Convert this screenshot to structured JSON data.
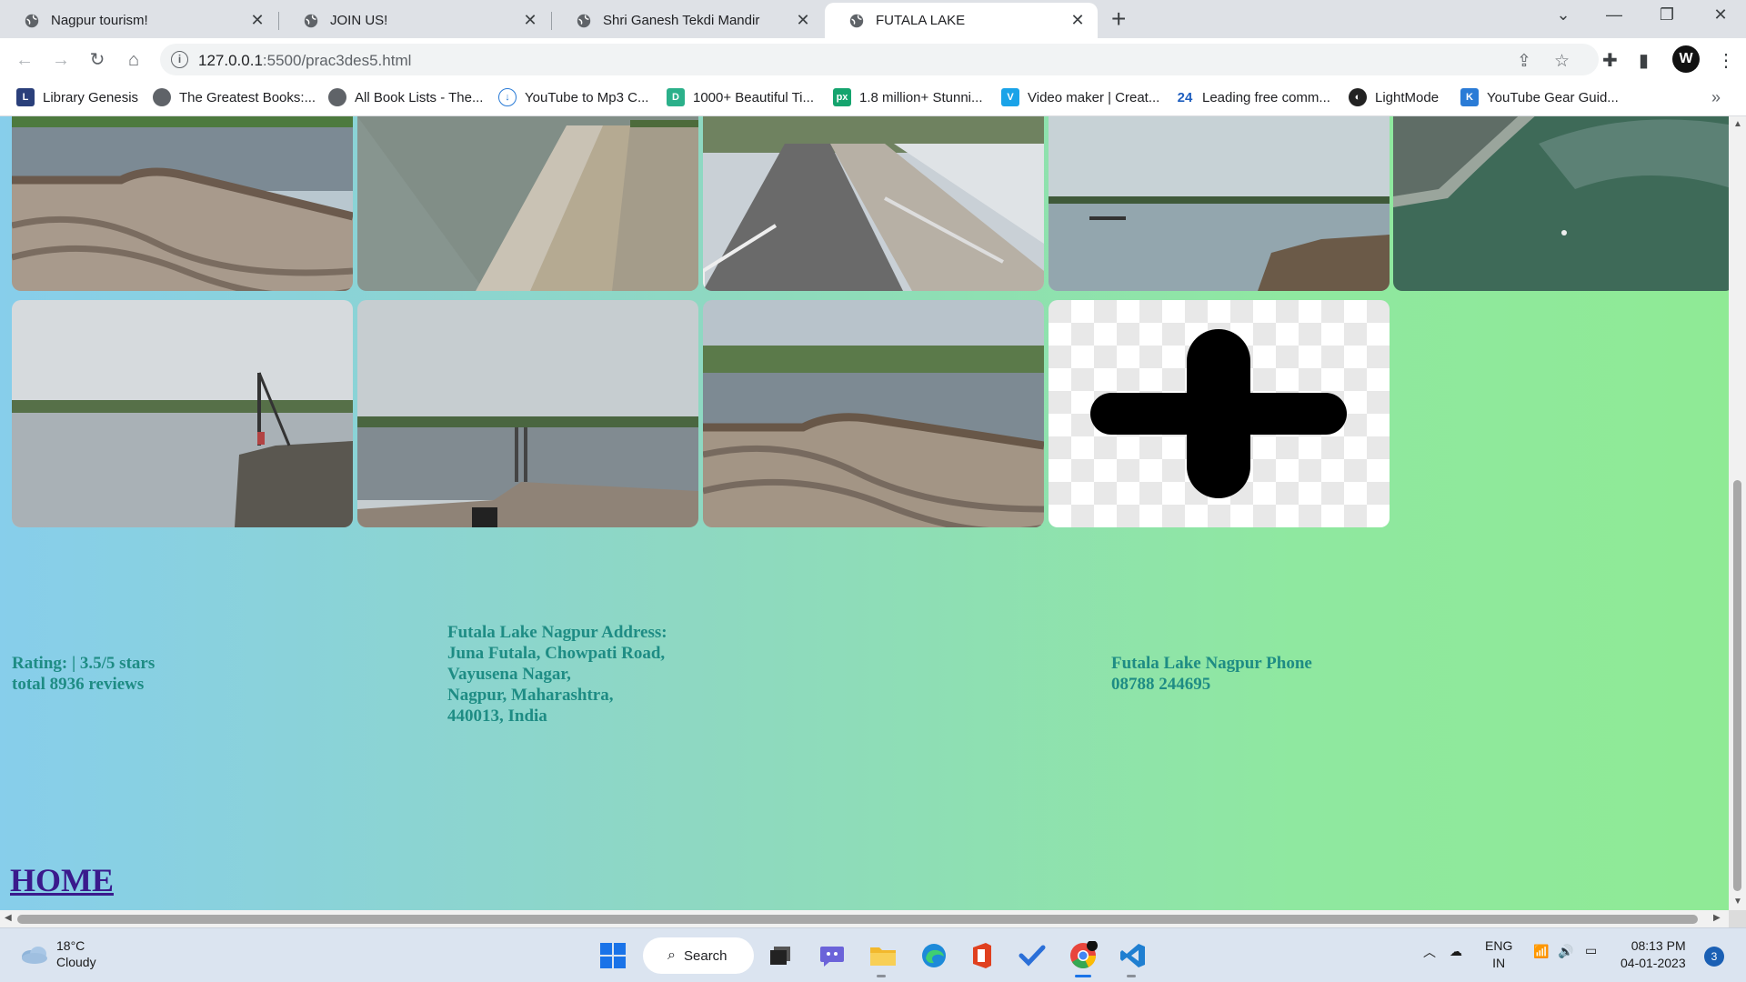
{
  "browser": {
    "tabs": [
      {
        "title": "Nagpur tourism!",
        "active": false
      },
      {
        "title": "JOIN US!",
        "active": false
      },
      {
        "title": "Shri Ganesh Tekdi Mandir",
        "active": false
      },
      {
        "title": "FUTALA LAKE",
        "active": true
      }
    ],
    "new_tab_label": "+",
    "url_host": "127.0.0.1",
    "url_rest": ":5500/prac3des5.html",
    "bookmarks": [
      {
        "label": "Library Genesis",
        "icon": "library-genesis-icon"
      },
      {
        "label": "The Greatest Books:...",
        "icon": "globe-icon"
      },
      {
        "label": "All Book Lists - The...",
        "icon": "globe-icon"
      },
      {
        "label": "YouTube to Mp3 C...",
        "icon": "cloud-download-icon"
      },
      {
        "label": "1000+ Beautiful Ti...",
        "icon": "d-letter-icon"
      },
      {
        "label": "1.8 million+ Stunni...",
        "icon": "px-icon"
      },
      {
        "label": "Video maker | Creat...",
        "icon": "v-letter-icon"
      },
      {
        "label": "Leading free comm...",
        "icon": "24-icon"
      },
      {
        "label": "LightMode",
        "icon": "lightmode-icon"
      },
      {
        "label": "YouTube Gear Guid...",
        "icon": "k-letter-icon"
      }
    ],
    "bookmarks_more": "»"
  },
  "page": {
    "rating_line1": "Rating: | 3.5/5 stars",
    "rating_line2": "total 8936 reviews",
    "address_title": "Futala Lake Nagpur Address:",
    "address_lines": [
      "Juna Futala, Chowpati Road,",
      "Vayusena Nagar,",
      "Nagpur, Maharashtra,",
      "440013, India"
    ],
    "phone_title": "Futala Lake Nagpur Phone",
    "phone_number": "08788 244695",
    "home_link": "HOME"
  },
  "taskbar": {
    "weather_temp": "18°C",
    "weather_desc": "Cloudy",
    "search_label": "Search",
    "lang_line1": "ENG",
    "lang_line2": "IN",
    "time": "08:13 PM",
    "date": "04-01-2023",
    "notification_count": "3"
  },
  "colors": {
    "page_text": "#1e8c84",
    "home_link": "#3a1a8c",
    "gradient_left": "#87ceeb",
    "gradient_right": "#8fea95"
  }
}
